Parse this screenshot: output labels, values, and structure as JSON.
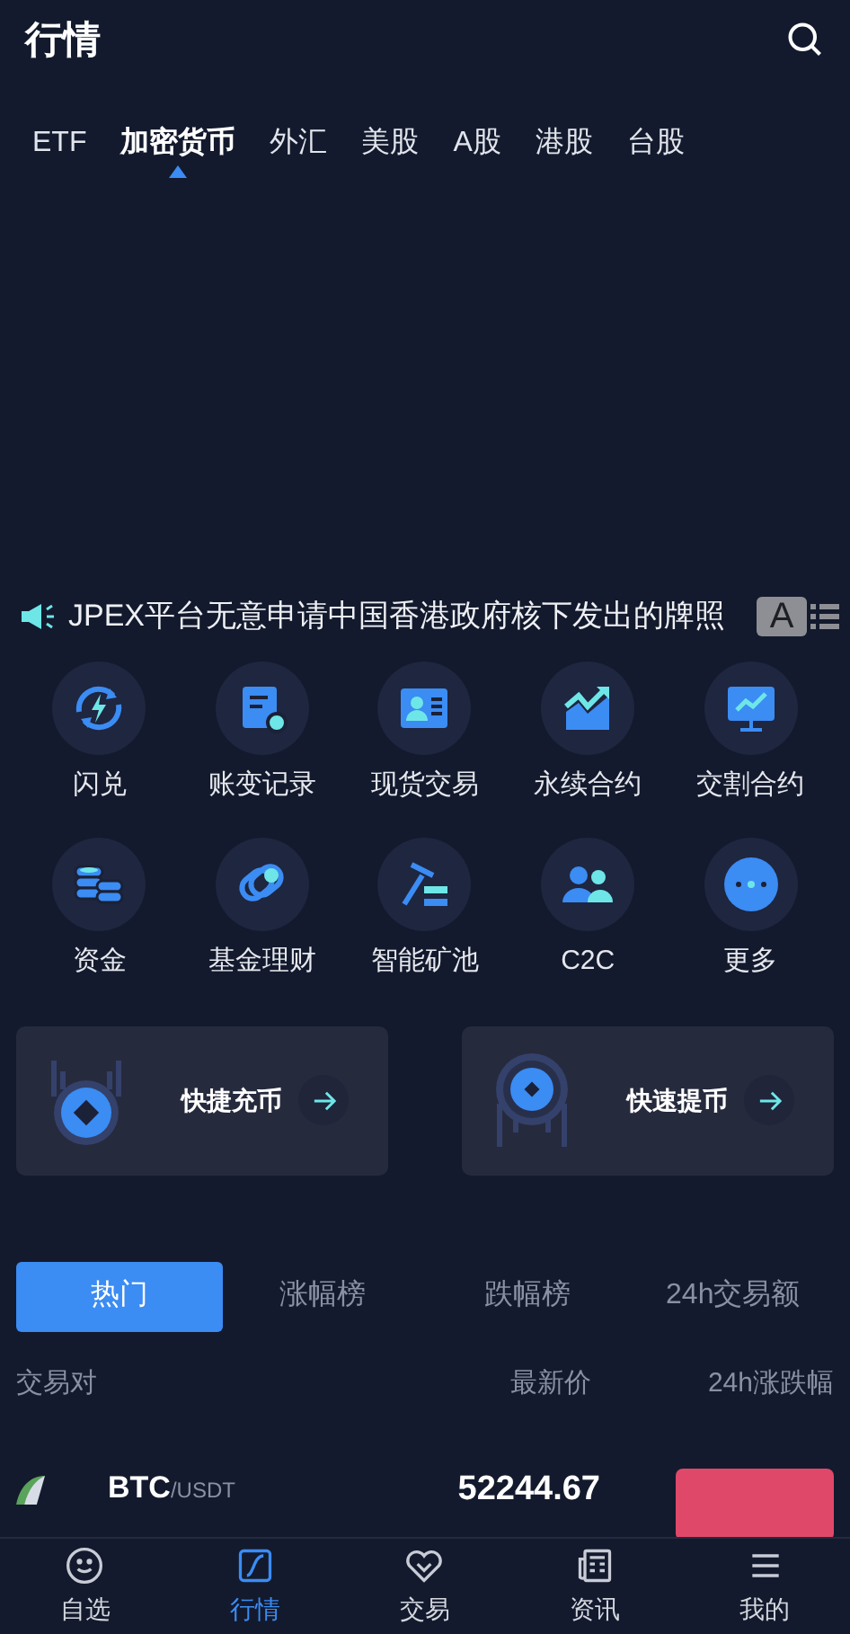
{
  "header": {
    "title": "行情"
  },
  "market_tabs": [
    {
      "label": "ETF",
      "selected": false
    },
    {
      "label": "加密货币",
      "selected": true
    },
    {
      "label": "外汇",
      "selected": false
    },
    {
      "label": "美股",
      "selected": false
    },
    {
      "label": "A股",
      "selected": false
    },
    {
      "label": "港股",
      "selected": false
    },
    {
      "label": "台股",
      "selected": false
    }
  ],
  "announcement": {
    "text": "JPEX平台无意申请中国香港政府核下发出的牌照",
    "font_button": "A"
  },
  "shortcuts": [
    {
      "label": "闪兑",
      "kind": "flash"
    },
    {
      "label": "账变记录",
      "kind": "record"
    },
    {
      "label": "现货交易",
      "kind": "spot"
    },
    {
      "label": "永续合约",
      "kind": "perpetual"
    },
    {
      "label": "交割合约",
      "kind": "delivery"
    },
    {
      "label": "资金",
      "kind": "funds"
    },
    {
      "label": "基金理财",
      "kind": "fund"
    },
    {
      "label": "智能矿池",
      "kind": "mining"
    },
    {
      "label": "C2C",
      "kind": "c2c"
    },
    {
      "label": "更多",
      "kind": "more"
    }
  ],
  "quick_cards": [
    {
      "label": "快捷充币",
      "kind": "deposit"
    },
    {
      "label": "快速提币",
      "kind": "withdraw"
    }
  ],
  "rank_tabs": [
    {
      "label": "热门",
      "selected": true
    },
    {
      "label": "涨幅榜",
      "selected": false
    },
    {
      "label": "跌幅榜",
      "selected": false
    },
    {
      "label": "24h交易额",
      "selected": false
    }
  ],
  "table": {
    "columns": [
      "交易对",
      "最新价",
      "24h涨跌幅"
    ],
    "rows": [
      {
        "base": "BTC",
        "quote": "/USDT",
        "price": "52244.67",
        "color": "#e0486a"
      }
    ]
  },
  "bottom_nav": [
    {
      "label": "自选",
      "kind": "watch",
      "selected": false
    },
    {
      "label": "行情",
      "kind": "market",
      "selected": true
    },
    {
      "label": "交易",
      "kind": "trade",
      "selected": false
    },
    {
      "label": "资讯",
      "kind": "news",
      "selected": false
    },
    {
      "label": "我的",
      "kind": "mine",
      "selected": false
    }
  ]
}
